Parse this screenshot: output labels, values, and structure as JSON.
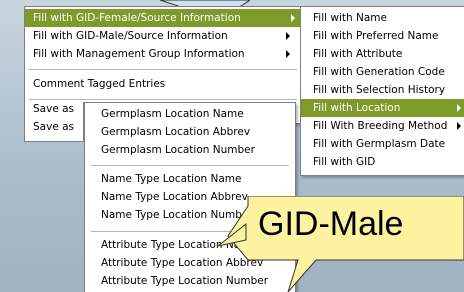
{
  "context_menu": {
    "items": [
      {
        "label": "Fill with GID-Female/Source Information"
      },
      {
        "label": "Fill with GID-Male/Source Information"
      },
      {
        "label": "Fill with Management Group Information"
      },
      {
        "label": "Comment Tagged Entries"
      },
      {
        "label": "Save as"
      },
      {
        "label": "Save as"
      }
    ]
  },
  "submenu_fill": {
    "items": [
      {
        "label": "Fill with Name"
      },
      {
        "label": "Fill with Preferred Name"
      },
      {
        "label": "Fill with Attribute"
      },
      {
        "label": "Fill with Generation Code"
      },
      {
        "label": "Fill with Selection History"
      },
      {
        "label": "Fill with Location"
      },
      {
        "label": "Fill With Breeding Method"
      },
      {
        "label": "Fill with Germplasm Date"
      },
      {
        "label": "Fill with GID"
      }
    ]
  },
  "submenu_location": {
    "items": [
      {
        "label": "Germplasm Location Name"
      },
      {
        "label": "Germplasm Location Abbrev"
      },
      {
        "label": "Germplasm Location  Number"
      },
      {
        "label": "Name Type Location Name"
      },
      {
        "label": "Name Type Location Abbrev"
      },
      {
        "label": "Name Type Location Number"
      },
      {
        "label": "Attribute Type Location Name"
      },
      {
        "label": "Attribute Type Location Abbrev"
      },
      {
        "label": "Attribute Type Location Number"
      }
    ]
  },
  "callout": {
    "text": "GID-Male"
  },
  "colors": {
    "highlight": "#7d9a2a",
    "callout_fill": "#fdf2a0"
  }
}
